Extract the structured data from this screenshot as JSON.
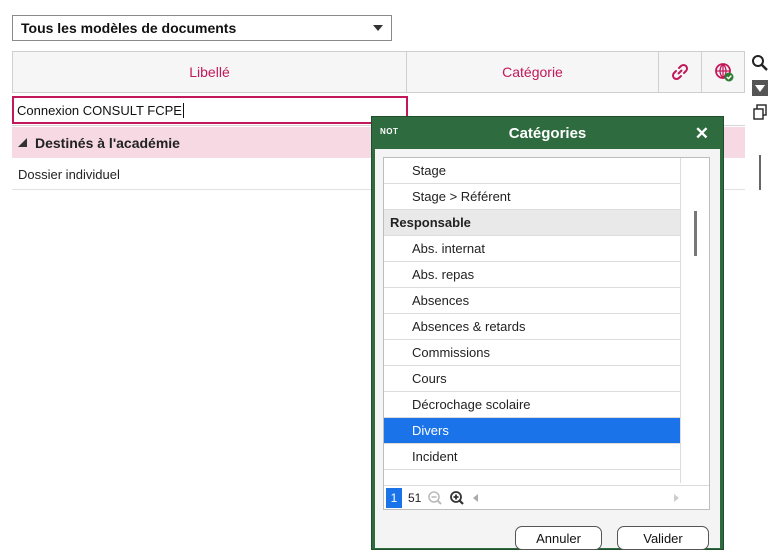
{
  "filter": {
    "value": "Tous les modèles de documents"
  },
  "table": {
    "columns": {
      "libelle": "Libellé",
      "categorie": "Catégorie"
    },
    "edit_value": "Connexion CONSULT FCPE",
    "group_label": "Destinés à l'académie",
    "rows": [
      {
        "libelle": "Dossier individuel"
      }
    ]
  },
  "colors": {
    "accent": "#c2185b",
    "dialog_green": "#2e6b3f",
    "selection": "#1a73e8",
    "group_bg": "#f6d9e2"
  },
  "dialog": {
    "badge": "NOT",
    "title": "Catégories",
    "close": "✕",
    "items": [
      {
        "label": "Stage",
        "type": "item"
      },
      {
        "label": "Stage > Référent",
        "type": "item"
      },
      {
        "label": "Responsable",
        "type": "section"
      },
      {
        "label": "Abs. internat",
        "type": "item"
      },
      {
        "label": "Abs. repas",
        "type": "item"
      },
      {
        "label": "Absences",
        "type": "item"
      },
      {
        "label": "Absences & retards",
        "type": "item"
      },
      {
        "label": "Commissions",
        "type": "item"
      },
      {
        "label": "Cours",
        "type": "item"
      },
      {
        "label": "Décrochage scolaire",
        "type": "item"
      },
      {
        "label": "Divers",
        "type": "selected"
      },
      {
        "label": "Incident",
        "type": "item"
      }
    ],
    "pagination": {
      "current": "1",
      "total": "51"
    },
    "buttons": {
      "cancel": "Annuler",
      "confirm": "Valider"
    }
  }
}
